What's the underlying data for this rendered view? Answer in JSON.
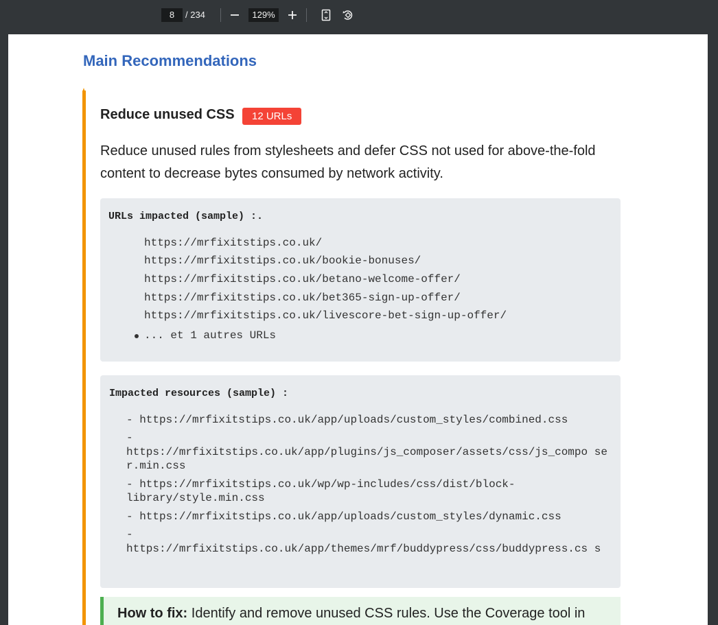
{
  "toolbar": {
    "page_current": "8",
    "page_total": "/ 234",
    "zoom": "129%",
    "icons": [
      "minus-icon",
      "plus-icon",
      "fit-page-icon",
      "rotate-icon"
    ]
  },
  "page": {
    "main_title": "Main Recommendations",
    "section_title": "Reduce unused CSS",
    "badge": "12 URLs",
    "description": "Reduce unused rules from stylesheets and defer CSS not used for above-the-fold content to decrease bytes consumed by network activity.",
    "urls_box": {
      "heading": "URLs impacted (sample) :.",
      "urls": [
        "https://mrfixitstips.co.uk/",
        "https://mrfixitstips.co.uk/bookie-bonuses/",
        "https://mrfixitstips.co.uk/betano-welcome-offer/",
        "https://mrfixitstips.co.uk/bet365-sign-up-offer/",
        "https://mrfixitstips.co.uk/livescore-bet-sign-up-offer/"
      ],
      "more": "... et 1 autres URLs"
    },
    "resources_box": {
      "heading": "Impacted resources (sample) :",
      "resources": [
        "- https://mrfixitstips.co.uk/app/uploads/custom_styles/combined.css",
        "- https://mrfixitstips.co.uk/app/plugins/js_composer/assets/css/js_composer.min.css",
        "- https://mrfixitstips.co.uk/wp/wp-includes/css/dist/block-library/style.min.css",
        "- https://mrfixitstips.co.uk/app/uploads/custom_styles/dynamic.css",
        "- https://mrfixitstips.co.uk/app/themes/mrf/buddypress/css/buddypress.css"
      ]
    },
    "fix": {
      "label": "How to fix:",
      "text": "Identify and remove unused CSS rules. Use the Coverage tool in"
    }
  },
  "colors": {
    "toolbar_bg": "#323639",
    "title_blue": "#3366bb",
    "accent_orange": "#f29400",
    "badge_red": "#f44336",
    "box_gray": "#e8ebee",
    "fix_green": "#4caf50"
  }
}
